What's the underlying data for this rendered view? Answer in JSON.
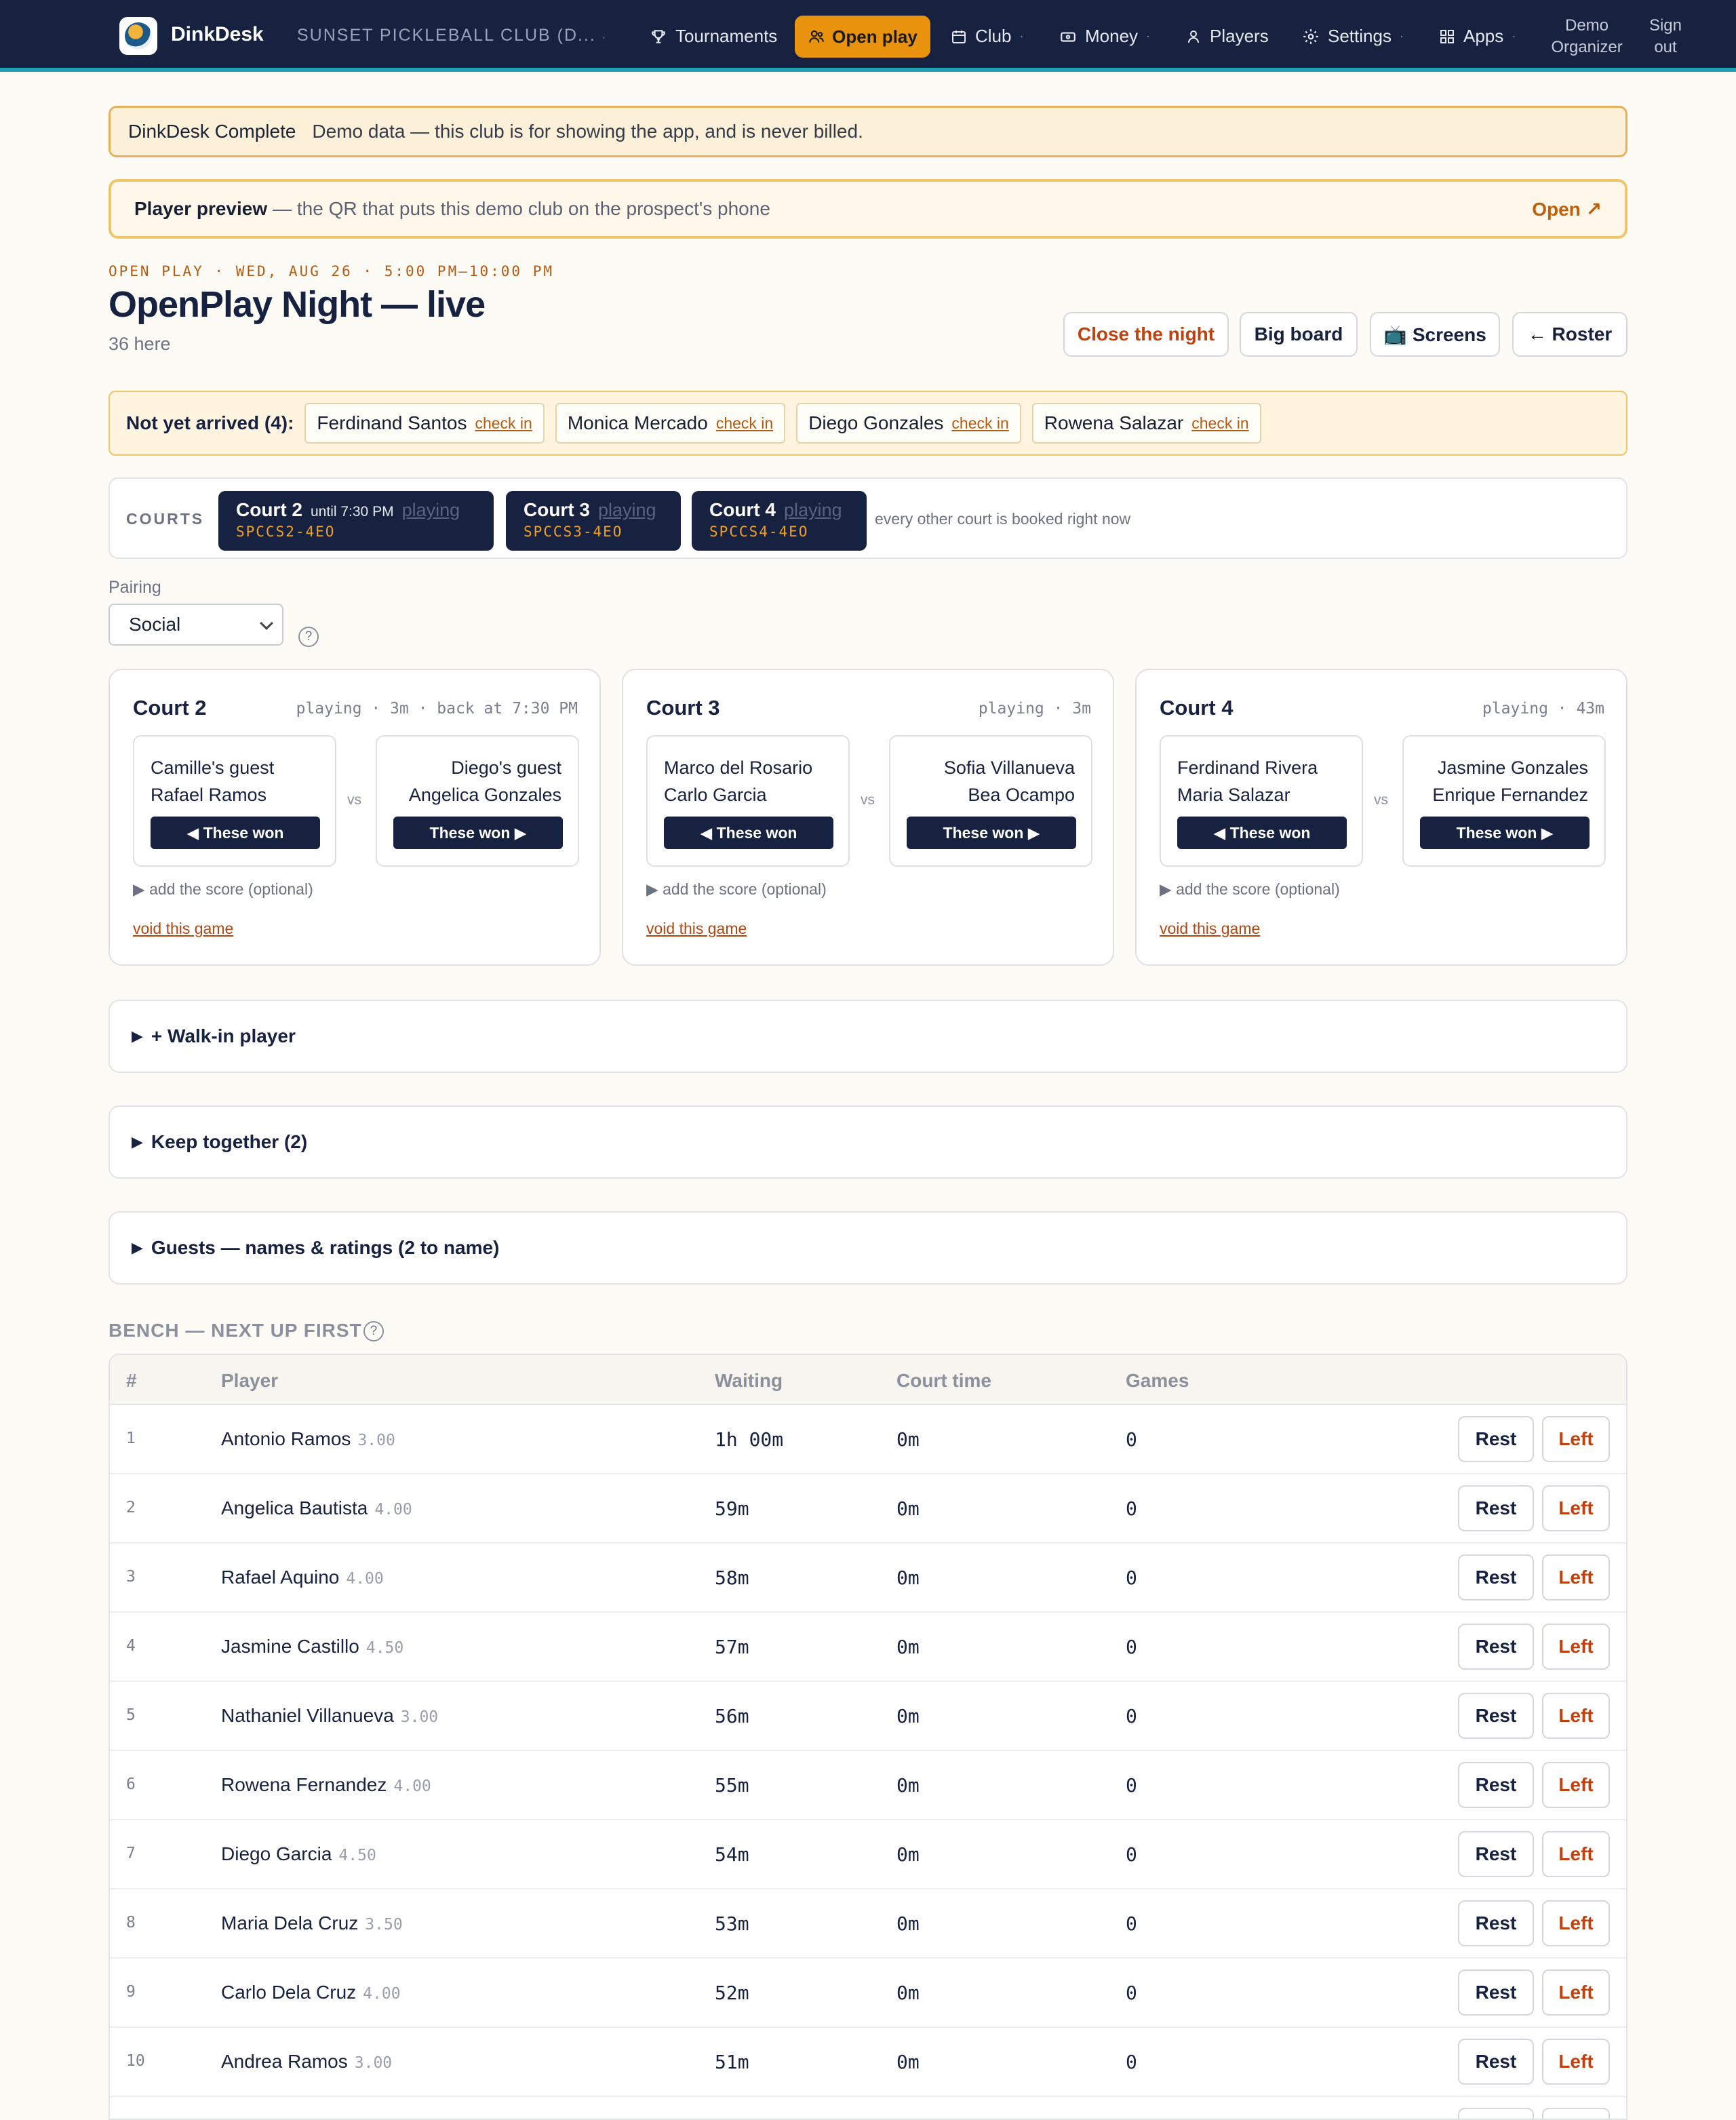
{
  "nav": {
    "brand": "DinkDesk",
    "club": "SUNSET PICKLEBALL CLUB (D...",
    "items": [
      {
        "label": "Tournaments",
        "icon": "trophy-icon"
      },
      {
        "label": "Open play",
        "icon": "people-icon"
      },
      {
        "label": "Club",
        "icon": "calendar-icon"
      },
      {
        "label": "Money",
        "icon": "money-icon"
      },
      {
        "label": "Players",
        "icon": "person-icon"
      },
      {
        "label": "Settings",
        "icon": "gear-icon"
      },
      {
        "label": "Apps",
        "icon": "grid-icon"
      }
    ],
    "user": "Demo Organizer",
    "signout": "Sign out"
  },
  "banner": {
    "plan": "DinkDesk Complete",
    "note": "Demo data — this club is for showing the app, and is never billed."
  },
  "preview": {
    "title": "Player preview",
    "text": "— the QR that puts this demo club on the prospect's phone",
    "open": "Open ↗"
  },
  "header": {
    "eyebrow": "OPEN PLAY · WED, AUG 26 · 5:00 PM–10:00 PM",
    "title": "OpenPlay Night — live",
    "count": "36 here",
    "buttons": {
      "close": "Close the night",
      "bigboard": "Big board",
      "screens": "📺 Screens",
      "roster": "← Roster"
    }
  },
  "arrivals": {
    "label": "Not yet arrived (4):",
    "checkin": "check in",
    "people": [
      "Ferdinand Santos",
      "Monica Mercado",
      "Diego Gonzales",
      "Rowena Salazar"
    ]
  },
  "courts_strip": {
    "label": "COURTS",
    "pills": [
      {
        "name": "Court 2",
        "until": "until 7:30 PM",
        "status": "playing",
        "code": "SPCCS2-4EO"
      },
      {
        "name": "Court 3",
        "until": "",
        "status": "playing",
        "code": "SPCCS3-4EO"
      },
      {
        "name": "Court 4",
        "until": "",
        "status": "playing",
        "code": "SPCCS4-4EO"
      }
    ],
    "note": "every other court is booked right now"
  },
  "pairing": {
    "label": "Pairing",
    "value": "Social",
    "help": "?"
  },
  "court_cards": [
    {
      "name": "Court 2",
      "status": "playing · 3m · back at 7:30 PM",
      "left": [
        "Camille's guest",
        "Rafael Ramos"
      ],
      "right": [
        "Diego's guest",
        "Angelica Gonzales"
      ]
    },
    {
      "name": "Court 3",
      "status": "playing · 3m",
      "left": [
        "Marco del Rosario",
        "Carlo Garcia"
      ],
      "right": [
        "Sofia Villanueva",
        "Bea Ocampo"
      ]
    },
    {
      "name": "Court 4",
      "status": "playing · 43m",
      "left": [
        "Ferdinand Rivera",
        "Maria Salazar"
      ],
      "right": [
        "Jasmine Gonzales",
        "Enrique Fernandez"
      ]
    }
  ],
  "card_labels": {
    "won_left": "◀ These won",
    "won_right": "These won ▶",
    "vs": "vs",
    "score": "▶ add the score (optional)",
    "void": "void this game"
  },
  "sections": {
    "walkin": "+ Walk-in player",
    "together": "Keep together (2)",
    "guests": "Guests — names & ratings (2 to name)"
  },
  "bench": {
    "title": "BENCH — NEXT UP FIRST",
    "columns": [
      "#",
      "Player",
      "Waiting",
      "Court time",
      "Games"
    ],
    "rest": "Rest",
    "left": "Left",
    "rows": [
      {
        "n": "1",
        "name": "Antonio Ramos",
        "rating": "3.00",
        "wait": "1h 00m",
        "court": "0m",
        "games": "0"
      },
      {
        "n": "2",
        "name": "Angelica Bautista",
        "rating": "4.00",
        "wait": "59m",
        "court": "0m",
        "games": "0"
      },
      {
        "n": "3",
        "name": "Rafael Aquino",
        "rating": "4.00",
        "wait": "58m",
        "court": "0m",
        "games": "0"
      },
      {
        "n": "4",
        "name": "Jasmine Castillo",
        "rating": "4.50",
        "wait": "57m",
        "court": "0m",
        "games": "0"
      },
      {
        "n": "5",
        "name": "Nathaniel Villanueva",
        "rating": "3.00",
        "wait": "56m",
        "court": "0m",
        "games": "0"
      },
      {
        "n": "6",
        "name": "Rowena Fernandez",
        "rating": "4.00",
        "wait": "55m",
        "court": "0m",
        "games": "0"
      },
      {
        "n": "7",
        "name": "Diego Garcia",
        "rating": "4.50",
        "wait": "54m",
        "court": "0m",
        "games": "0"
      },
      {
        "n": "8",
        "name": "Maria Dela Cruz",
        "rating": "3.50",
        "wait": "53m",
        "court": "0m",
        "games": "0"
      },
      {
        "n": "9",
        "name": "Carlo Dela Cruz",
        "rating": "4.00",
        "wait": "52m",
        "court": "0m",
        "games": "0"
      },
      {
        "n": "10",
        "name": "Andrea Ramos",
        "rating": "3.00",
        "wait": "51m",
        "court": "0m",
        "games": "0"
      }
    ]
  },
  "colors": {
    "navy": "#172140",
    "accent": "#e8920d",
    "teal": "#21a3b4",
    "danger": "#c0410d"
  }
}
